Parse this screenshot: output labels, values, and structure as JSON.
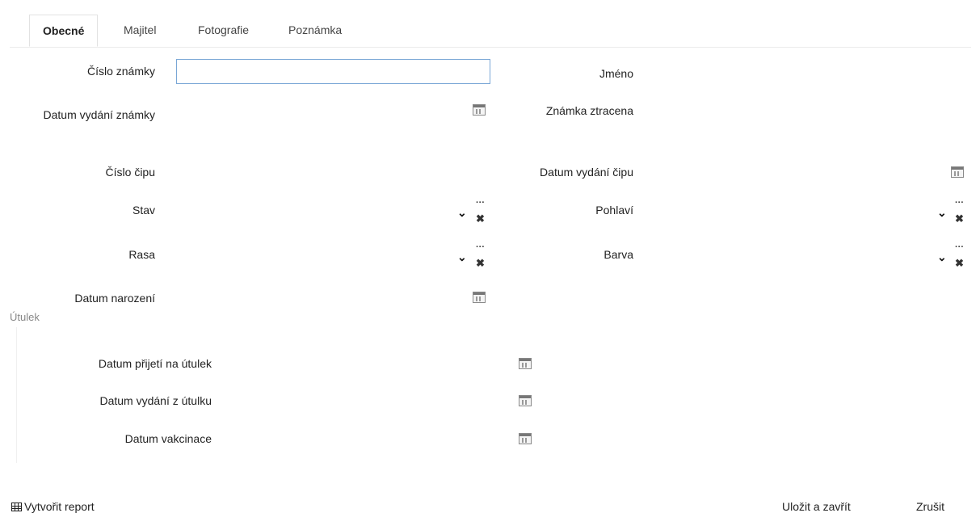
{
  "tabs": [
    "Obecné",
    "Majitel",
    "Fotografie",
    "Poznámka"
  ],
  "fields": {
    "cislo_znamky": "Číslo známky",
    "jmeno": "Jméno",
    "datum_vydani_znamky": "Datum vydání známky",
    "znamka_ztracena": "Známka ztracena",
    "cislo_cipu": "Číslo čipu",
    "datum_vydani_cipu": "Datum vydání čipu",
    "stav": "Stav",
    "pohlavi": "Pohlaví",
    "rasa": "Rasa",
    "barva": "Barva",
    "datum_narozeni": "Datum narození"
  },
  "inputs": {
    "cislo_znamky_value": ""
  },
  "utulek": {
    "title": "Útulek",
    "datum_prijeti": "Datum přijetí na útulek",
    "datum_vydani": "Datum vydání z útulku",
    "datum_vakcinace": "Datum vakcinace"
  },
  "footer": {
    "report": "Vytvořit report",
    "save_close": "Uložit a zavřít",
    "cancel": "Zrušit"
  },
  "icons": {
    "calendar": "calendar-icon",
    "dropdown": "chevron-down-icon",
    "more": "more-icon",
    "clear": "close-icon",
    "report": "table-icon"
  }
}
